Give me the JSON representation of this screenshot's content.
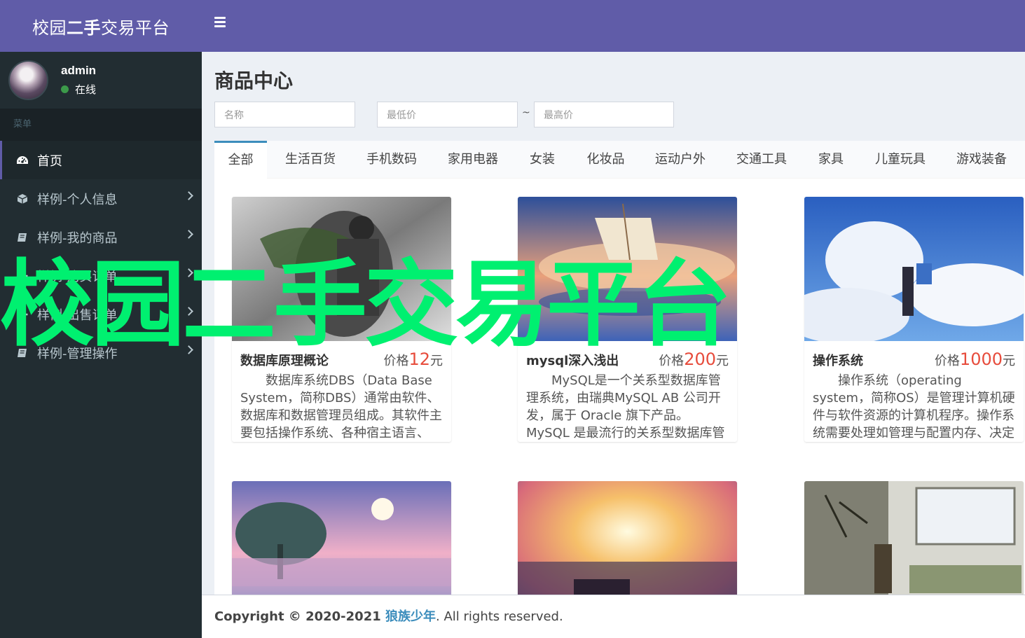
{
  "app": {
    "logo_prefix": "校园",
    "logo_bold": "二手",
    "logo_suffix": "交易平台"
  },
  "user": {
    "name": "admin",
    "status": "在线"
  },
  "sidebar": {
    "header": "菜单",
    "items": [
      {
        "label": "首页",
        "icon": "dashboard-icon",
        "active": true
      },
      {
        "label": "样例-个人信息",
        "icon": "cube-icon"
      },
      {
        "label": "样例-我的商品",
        "icon": "book-icon"
      },
      {
        "label": "样例-购买订单",
        "icon": "gear-icon"
      },
      {
        "label": "样例-出售订单",
        "icon": "gear-icon"
      },
      {
        "label": "样例-管理操作",
        "icon": "book-icon"
      }
    ]
  },
  "page": {
    "title": "商品中心"
  },
  "filters": {
    "name_placeholder": "名称",
    "min_price_placeholder": "最低价",
    "separator": "~",
    "max_price_placeholder": "最高价"
  },
  "tabs": [
    "全部",
    "生活百货",
    "手机数码",
    "家用电器",
    "女装",
    "化妆品",
    "运动户外",
    "交通工具",
    "家具",
    "儿童玩具",
    "游戏装备"
  ],
  "products": [
    {
      "title": "数据库原理概论",
      "price_label": "价格",
      "price": "12",
      "unit": "元",
      "desc": "数据库系统DBS（Data Base System，简称DBS）通常由软件、数据库和数据管理员组成。其软件主要包括操作系统、各种宿主语言、实..."
    },
    {
      "title": "mysql深入浅出",
      "price_label": "价格",
      "price": "200",
      "unit": "元",
      "desc": "MySQL是一个关系型数据库管理系统，由瑞典MySQL AB 公司开发，属于 Oracle 旗下产品。MySQL 是最流行的关系型数据库管理系统之一..."
    },
    {
      "title": "操作系统",
      "price_label": "价格",
      "price": "1000",
      "unit": "元",
      "desc": "操作系统（operating system，简称OS）是管理计算机硬件与软件资源的计算机程序。操作系统需要处理如管理与配置内存、决定系统资源..."
    }
  ],
  "footer": {
    "copyright": "Copyright © 2020-2021 ",
    "author": "狼族少年",
    "rights": ". All rights reserved."
  },
  "watermark": "校园二手交易平台",
  "colors": {
    "brand": "#605ca8",
    "sidebar": "#222d32",
    "price": "#e74c3c",
    "link": "#3c8dbc",
    "watermark": "#00f070"
  }
}
